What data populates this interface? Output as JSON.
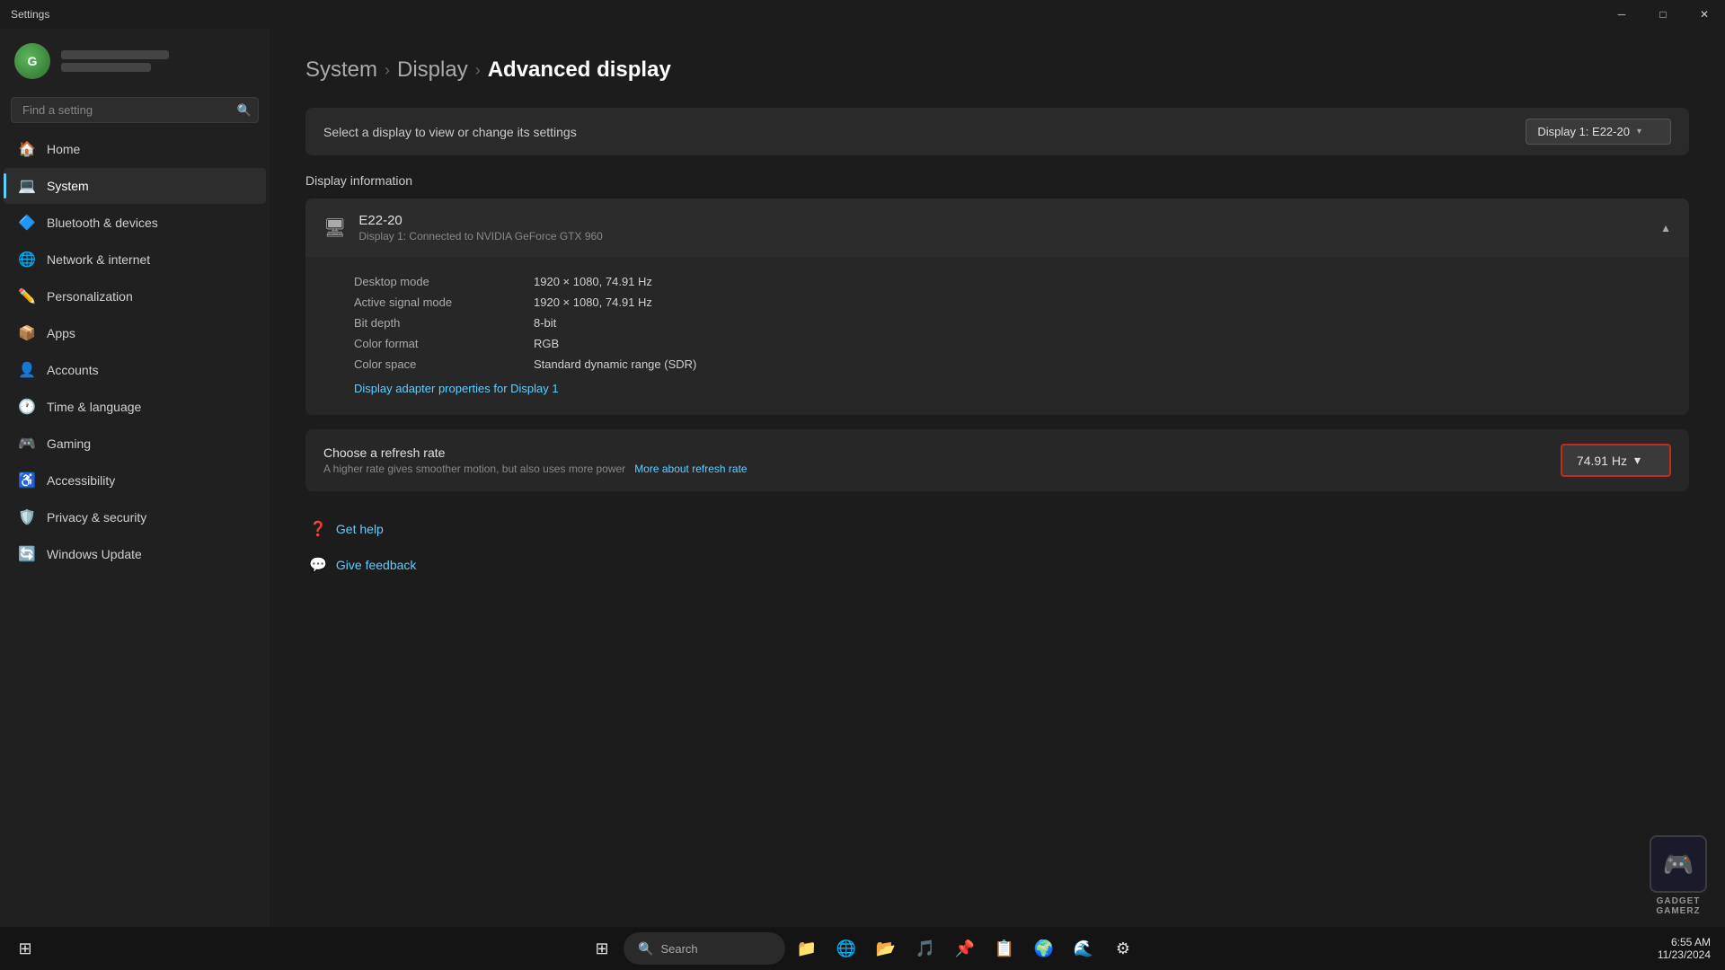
{
  "titleBar": {
    "title": "Settings",
    "minBtn": "─",
    "maxBtn": "□",
    "closeBtn": "✕"
  },
  "sidebar": {
    "searchPlaceholder": "Find a setting",
    "navItems": [
      {
        "id": "home",
        "label": "Home",
        "icon": "🏠",
        "active": false
      },
      {
        "id": "system",
        "label": "System",
        "icon": "💻",
        "active": true
      },
      {
        "id": "bluetooth",
        "label": "Bluetooth & devices",
        "icon": "🔷",
        "active": false
      },
      {
        "id": "network",
        "label": "Network & internet",
        "icon": "🌐",
        "active": false
      },
      {
        "id": "personalization",
        "label": "Personalization",
        "icon": "✏️",
        "active": false
      },
      {
        "id": "apps",
        "label": "Apps",
        "icon": "📦",
        "active": false
      },
      {
        "id": "accounts",
        "label": "Accounts",
        "icon": "👤",
        "active": false
      },
      {
        "id": "time",
        "label": "Time & language",
        "icon": "🕐",
        "active": false
      },
      {
        "id": "gaming",
        "label": "Gaming",
        "icon": "🎮",
        "active": false
      },
      {
        "id": "accessibility",
        "label": "Accessibility",
        "icon": "♿",
        "active": false
      },
      {
        "id": "privacy",
        "label": "Privacy & security",
        "icon": "🛡️",
        "active": false
      },
      {
        "id": "update",
        "label": "Windows Update",
        "icon": "🔄",
        "active": false
      }
    ]
  },
  "breadcrumb": {
    "crumb1": "System",
    "crumb2": "Display",
    "current": "Advanced display"
  },
  "displaySelector": {
    "label": "Select a display to view or change its settings",
    "selectedDisplay": "Display 1: E22-20"
  },
  "displayInfo": {
    "sectionTitle": "Display information",
    "monitorName": "E22-20",
    "monitorSub": "Display 1: Connected to NVIDIA GeForce GTX 960",
    "rows": [
      {
        "label": "Desktop mode",
        "value": "1920 × 1080, 74.91 Hz"
      },
      {
        "label": "Active signal mode",
        "value": "1920 × 1080, 74.91 Hz"
      },
      {
        "label": "Bit depth",
        "value": "8-bit"
      },
      {
        "label": "Color format",
        "value": "RGB"
      },
      {
        "label": "Color space",
        "value": "Standard dynamic range (SDR)"
      }
    ],
    "adapterLink": "Display adapter properties for Display 1"
  },
  "refreshRate": {
    "title": "Choose a refresh rate",
    "desc": "A higher rate gives smoother motion, but also uses more power",
    "linkText": "More about refresh rate",
    "selectedRate": "74.91 Hz"
  },
  "helpSection": {
    "getHelp": "Get help",
    "giveFeedback": "Give feedback"
  },
  "taskbar": {
    "searchText": "Search",
    "time": "6:55 AM",
    "date": "11/23/2024"
  },
  "watermark": {
    "brand": "GADGET\nGAMERZ"
  }
}
